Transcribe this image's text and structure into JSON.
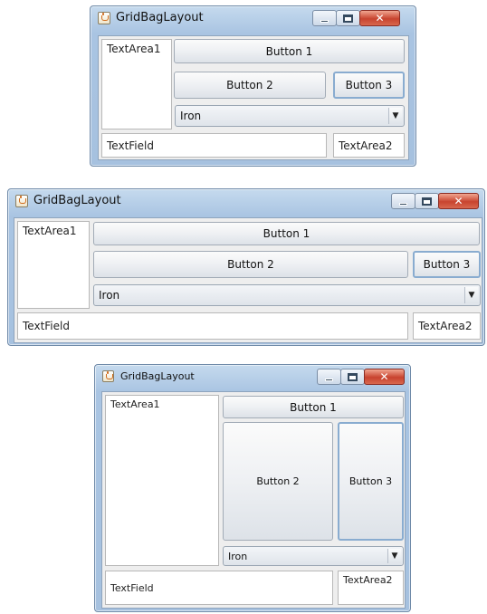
{
  "windows": [
    {
      "title": "GridBagLayout",
      "components": {
        "textarea1": "TextArea1",
        "button1": "Button 1",
        "button2": "Button 2",
        "button3": "Button 3",
        "combo_selected": "Iron",
        "textfield": "TextField",
        "textarea2": "TextArea2"
      }
    },
    {
      "title": "GridBagLayout",
      "components": {
        "textarea1": "TextArea1",
        "button1": "Button 1",
        "button2": "Button 2",
        "button3": "Button 3",
        "combo_selected": "Iron",
        "textfield": "TextField",
        "textarea2": "TextArea2"
      }
    },
    {
      "title": "GridBagLayout",
      "components": {
        "textarea1": "TextArea1",
        "button1": "Button 1",
        "button2": "Button 2",
        "button3": "Button 3",
        "combo_selected": "Iron",
        "textfield": "TextField",
        "textarea2": "TextArea2"
      }
    }
  ],
  "icons": {
    "app": "java-icon",
    "minimize": "minimize-icon",
    "maximize": "maximize-icon",
    "close": "close-icon",
    "combo_arrow": "chevron-down-icon"
  },
  "colors": {
    "titlebar": "#b7cde6",
    "close_button": "#c8432f",
    "client_bg": "#eeeeee"
  }
}
